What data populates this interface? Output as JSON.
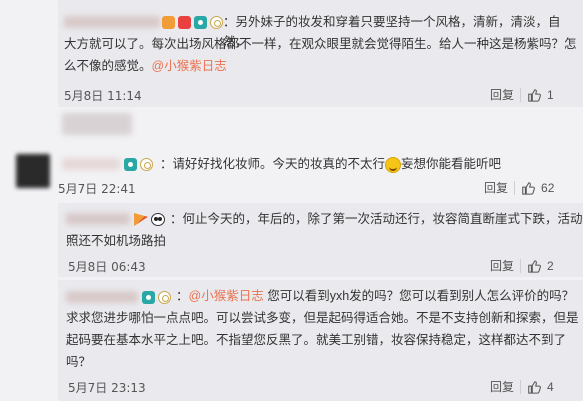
{
  "comments": [
    {
      "text_line1": "：另外妹子的妆发和穿着只要坚持一个风格，清新，清淡，自然，",
      "text_line2": "大方就可以了。每次出场风格都不一样，在观众眼里就会觉得陌生。给人一种这是杨紫吗？怎",
      "text_line3_plain": "么不像的感觉。",
      "text_line3_link": "@小猴紫日志",
      "date": "5月8日 11:14",
      "reply_label": "回复",
      "likes": "1"
    },
    {
      "text_before_emoji": "：请好好找化妆师。今天的妆真的不太行",
      "emoji_name": "smile-emoji",
      "text_after_emoji": "妄想你能看能听吧",
      "date": "5月7日 22:41",
      "reply_label": "回复",
      "likes": "62"
    },
    {
      "text_line1": "：何止今天的，年后的，除了第一次活动还行，妆容简直断崖式下跌，活动",
      "text_line2": "照还不如机场路拍",
      "date": "5月8日 06:43",
      "reply_label": "回复",
      "likes": "2"
    },
    {
      "text_line1_prefix": "：",
      "text_line1_link": "@小猴紫日志",
      "text_line1_rest": " 您可以看到yxh发的吗？您可以看到别人怎么评价的吗？",
      "text_line2": "求求您进步哪怕一点点吧。可以尝试多变，但是起码得适合她。不是不支持创新和探索，但是",
      "text_line3": "起码要在基本水平之上吧。不指望您反黑了。就美工别错，妆容保持稳定，这样都达不到了",
      "text_line4": "吗？",
      "date": "5月7日 23:13",
      "reply_label": "回复",
      "likes": "4"
    }
  ]
}
